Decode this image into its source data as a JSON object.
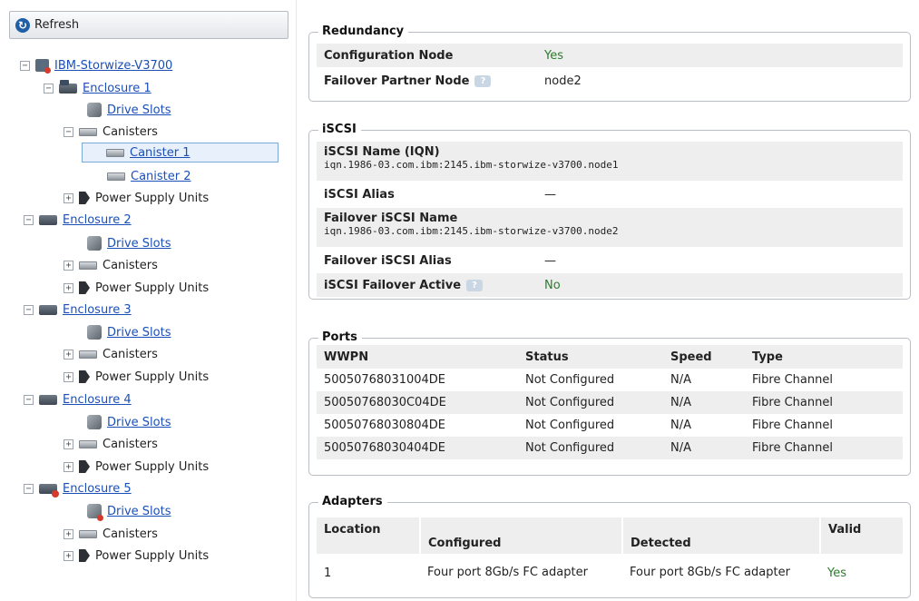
{
  "tree": {
    "refresh_label": "Refresh",
    "system_label": "IBM-Storwize-V3700",
    "enclosures": [
      {
        "label": "Enclosure 1",
        "drive_slots": "Drive Slots",
        "canisters": "Canisters",
        "canister_items": [
          "Canister 1",
          "Canister 2"
        ],
        "psu": "Power Supply Units"
      },
      {
        "label": "Enclosure 2",
        "drive_slots": "Drive Slots",
        "canisters": "Canisters",
        "psu": "Power Supply Units"
      },
      {
        "label": "Enclosure 3",
        "drive_slots": "Drive Slots",
        "canisters": "Canisters",
        "psu": "Power Supply Units"
      },
      {
        "label": "Enclosure 4",
        "drive_slots": "Drive Slots",
        "canisters": "Canisters",
        "psu": "Power Supply Units"
      },
      {
        "label": "Enclosure 5",
        "drive_slots": "Drive Slots",
        "canisters": "Canisters",
        "psu": "Power Supply Units"
      }
    ],
    "selected": "Canister 1"
  },
  "redundancy": {
    "title": "Redundancy",
    "config_node_label": "Configuration Node",
    "config_node_value": "Yes",
    "failover_partner_label": "Failover Partner Node",
    "failover_partner_value": "node2"
  },
  "iscsi": {
    "title": "iSCSI",
    "name_label": "iSCSI Name (IQN)",
    "name_value": "iqn.1986-03.com.ibm:2145.ibm-storwize-v3700.node1",
    "alias_label": "iSCSI Alias",
    "alias_value": "—",
    "failover_name_label": "Failover iSCSI Name",
    "failover_name_value": "iqn.1986-03.com.ibm:2145.ibm-storwize-v3700.node2",
    "failover_alias_label": "Failover iSCSI Alias",
    "failover_alias_value": "—",
    "failover_active_label": "iSCSI Failover Active",
    "failover_active_value": "No"
  },
  "ports": {
    "title": "Ports",
    "columns": [
      "WWPN",
      "Status",
      "Speed",
      "Type"
    ],
    "rows": [
      [
        "50050768031004DE",
        "Not Configured",
        "N/A",
        "Fibre Channel"
      ],
      [
        "50050768030C04DE",
        "Not Configured",
        "N/A",
        "Fibre Channel"
      ],
      [
        "50050768030804DE",
        "Not Configured",
        "N/A",
        "Fibre Channel"
      ],
      [
        "50050768030404DE",
        "Not Configured",
        "N/A",
        "Fibre Channel"
      ]
    ]
  },
  "adapters": {
    "title": "Adapters",
    "columns": [
      "Location",
      "Configured",
      "Detected",
      "Valid"
    ],
    "rows": [
      [
        "1",
        "Four port 8Gb/s FC adapter",
        "Four port 8Gb/s FC adapter",
        "Yes"
      ]
    ]
  },
  "colors": {
    "link": "#1a4fb8",
    "ok_green": "#2c7d2c",
    "shaded_row": "#eeeeee",
    "panel_border": "#b9bec4"
  },
  "icons": [
    "refresh-icon",
    "system-icon",
    "enclosure-icon",
    "drive-slots-icon",
    "canister-icon",
    "power-supply-icon",
    "help-icon"
  ]
}
